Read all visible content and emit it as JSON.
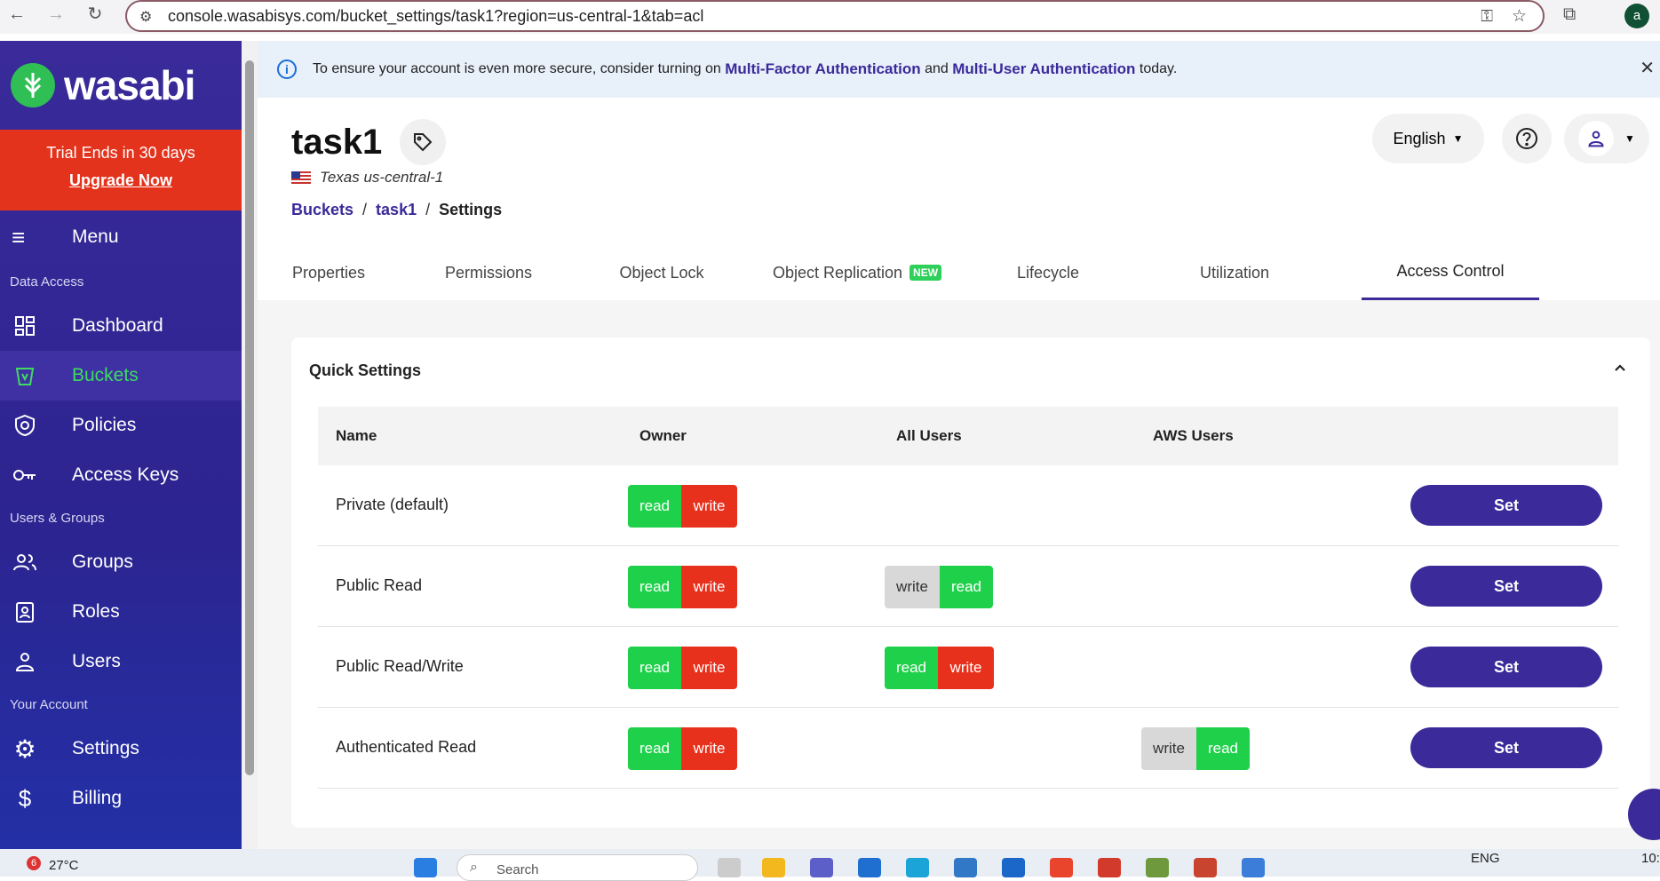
{
  "browser": {
    "url": "console.wasabisys.com/bucket_settings/task1?region=us-central-1&tab=acl",
    "profile_initial": "a"
  },
  "sidebar": {
    "brand": "wasabi",
    "trial_text": "Trial Ends in 30 days",
    "upgrade_label": "Upgrade Now",
    "menu_label": "Menu",
    "sections": [
      "Data Access",
      "Users & Groups",
      "Your Account"
    ],
    "items": [
      {
        "label": "Dashboard",
        "icon": "dashboard-icon"
      },
      {
        "label": "Buckets",
        "icon": "bucket-icon",
        "active": true
      },
      {
        "label": "Policies",
        "icon": "shield-icon"
      },
      {
        "label": "Access Keys",
        "icon": "key-icon"
      },
      {
        "label": "Groups",
        "icon": "group-icon"
      },
      {
        "label": "Roles",
        "icon": "badge-icon"
      },
      {
        "label": "Users",
        "icon": "user-icon"
      },
      {
        "label": "Settings",
        "icon": "gear-icon"
      },
      {
        "label": "Billing",
        "icon": "dollar-icon"
      }
    ]
  },
  "banner": {
    "prefix": "To ensure your account is even more secure, consider turning on",
    "link1": "Multi-Factor Authentication",
    "mid": "and",
    "link2": "Multi-User Authentication",
    "suffix": "today."
  },
  "header": {
    "bucket_name": "task1",
    "region": "Texas us-central-1",
    "language": "English"
  },
  "breadcrumb": {
    "buckets": "Buckets",
    "bucket": "task1",
    "current": "Settings"
  },
  "tabs": [
    {
      "label": "Properties"
    },
    {
      "label": "Permissions"
    },
    {
      "label": "Object Lock"
    },
    {
      "label": "Object Replication",
      "badge": "NEW"
    },
    {
      "label": "Lifecycle"
    },
    {
      "label": "Utilization"
    },
    {
      "label": "Access Control",
      "active": true
    }
  ],
  "quick_settings": {
    "title": "Quick Settings",
    "columns": [
      "Name",
      "Owner",
      "All Users",
      "AWS Users"
    ],
    "set_label": "Set",
    "rows": [
      {
        "name": "Private (default)",
        "owner": [
          "read",
          "write"
        ],
        "all_users": [],
        "aws_users": []
      },
      {
        "name": "Public Read",
        "owner": [
          "read",
          "write"
        ],
        "all_users": [
          "write",
          "read"
        ],
        "aws_users": []
      },
      {
        "name": "Public Read/Write",
        "owner": [
          "read",
          "write"
        ],
        "all_users": [
          "read",
          "write"
        ],
        "aws_users": []
      },
      {
        "name": "Authenticated Read",
        "owner": [
          "read",
          "write"
        ],
        "all_users": [],
        "aws_users": [
          "write",
          "read"
        ]
      }
    ]
  },
  "taskbar": {
    "badge_count": "6",
    "temperature": "27°C",
    "search_placeholder": "Search",
    "lang": "ENG",
    "clock": "10:"
  },
  "colors": {
    "brand_purple": "#3a2a9a",
    "grant_green": "#1fd04a",
    "deny_red": "#e8311c",
    "neutral_gray": "#d8d8d8"
  }
}
